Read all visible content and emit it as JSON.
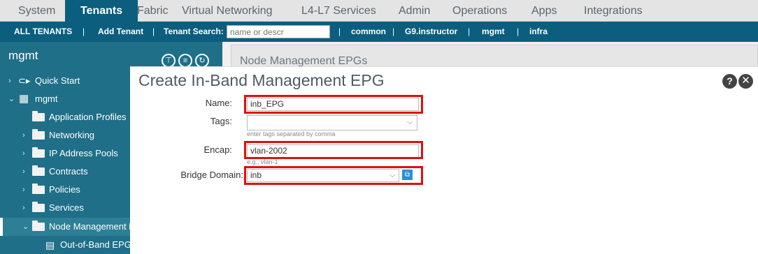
{
  "topnav": {
    "tabs": [
      {
        "label": "System"
      },
      {
        "label": "Tenants"
      },
      {
        "label": "Fabric"
      },
      {
        "label": "Virtual Networking"
      },
      {
        "label": "L4-L7 Services"
      },
      {
        "label": "Admin"
      },
      {
        "label": "Operations"
      },
      {
        "label": "Apps"
      },
      {
        "label": "Integrations"
      }
    ],
    "active": "Tenants"
  },
  "subnav": {
    "all_tenants": "ALL TENANTS",
    "sep": "|",
    "add_tenant": "Add Tenant",
    "tenant_search_label": "Tenant Search:",
    "tenant_search_placeholder": "name or descr",
    "tenants": [
      "common",
      "G9.instructor",
      "mgmt",
      "infra"
    ]
  },
  "sidebar": {
    "title": "mgmt",
    "items": [
      {
        "label": "Quick Start"
      },
      {
        "label": "mgmt"
      },
      {
        "label": "Application Profiles"
      },
      {
        "label": "Networking"
      },
      {
        "label": "IP Address Pools"
      },
      {
        "label": "Contracts"
      },
      {
        "label": "Policies"
      },
      {
        "label": "Services"
      },
      {
        "label": "Node Management EI"
      },
      {
        "label": "Out-of-Band EPG"
      }
    ]
  },
  "behind_panel": {
    "header": "Node Management EPGs"
  },
  "modal": {
    "title": "Create In-Band Management EPG",
    "help": "?",
    "close": "✕",
    "fields": {
      "name": {
        "label": "Name:",
        "value": "inb_EPG"
      },
      "tags": {
        "label": "Tags:",
        "value": "",
        "hint": "enter tags separated by comma"
      },
      "encap": {
        "label": "Encap:",
        "value": "vlan-2002",
        "hint": "e.g., vlan-1"
      },
      "bridge_domain": {
        "label": "Bridge Domain:",
        "value": "inb"
      }
    }
  }
}
